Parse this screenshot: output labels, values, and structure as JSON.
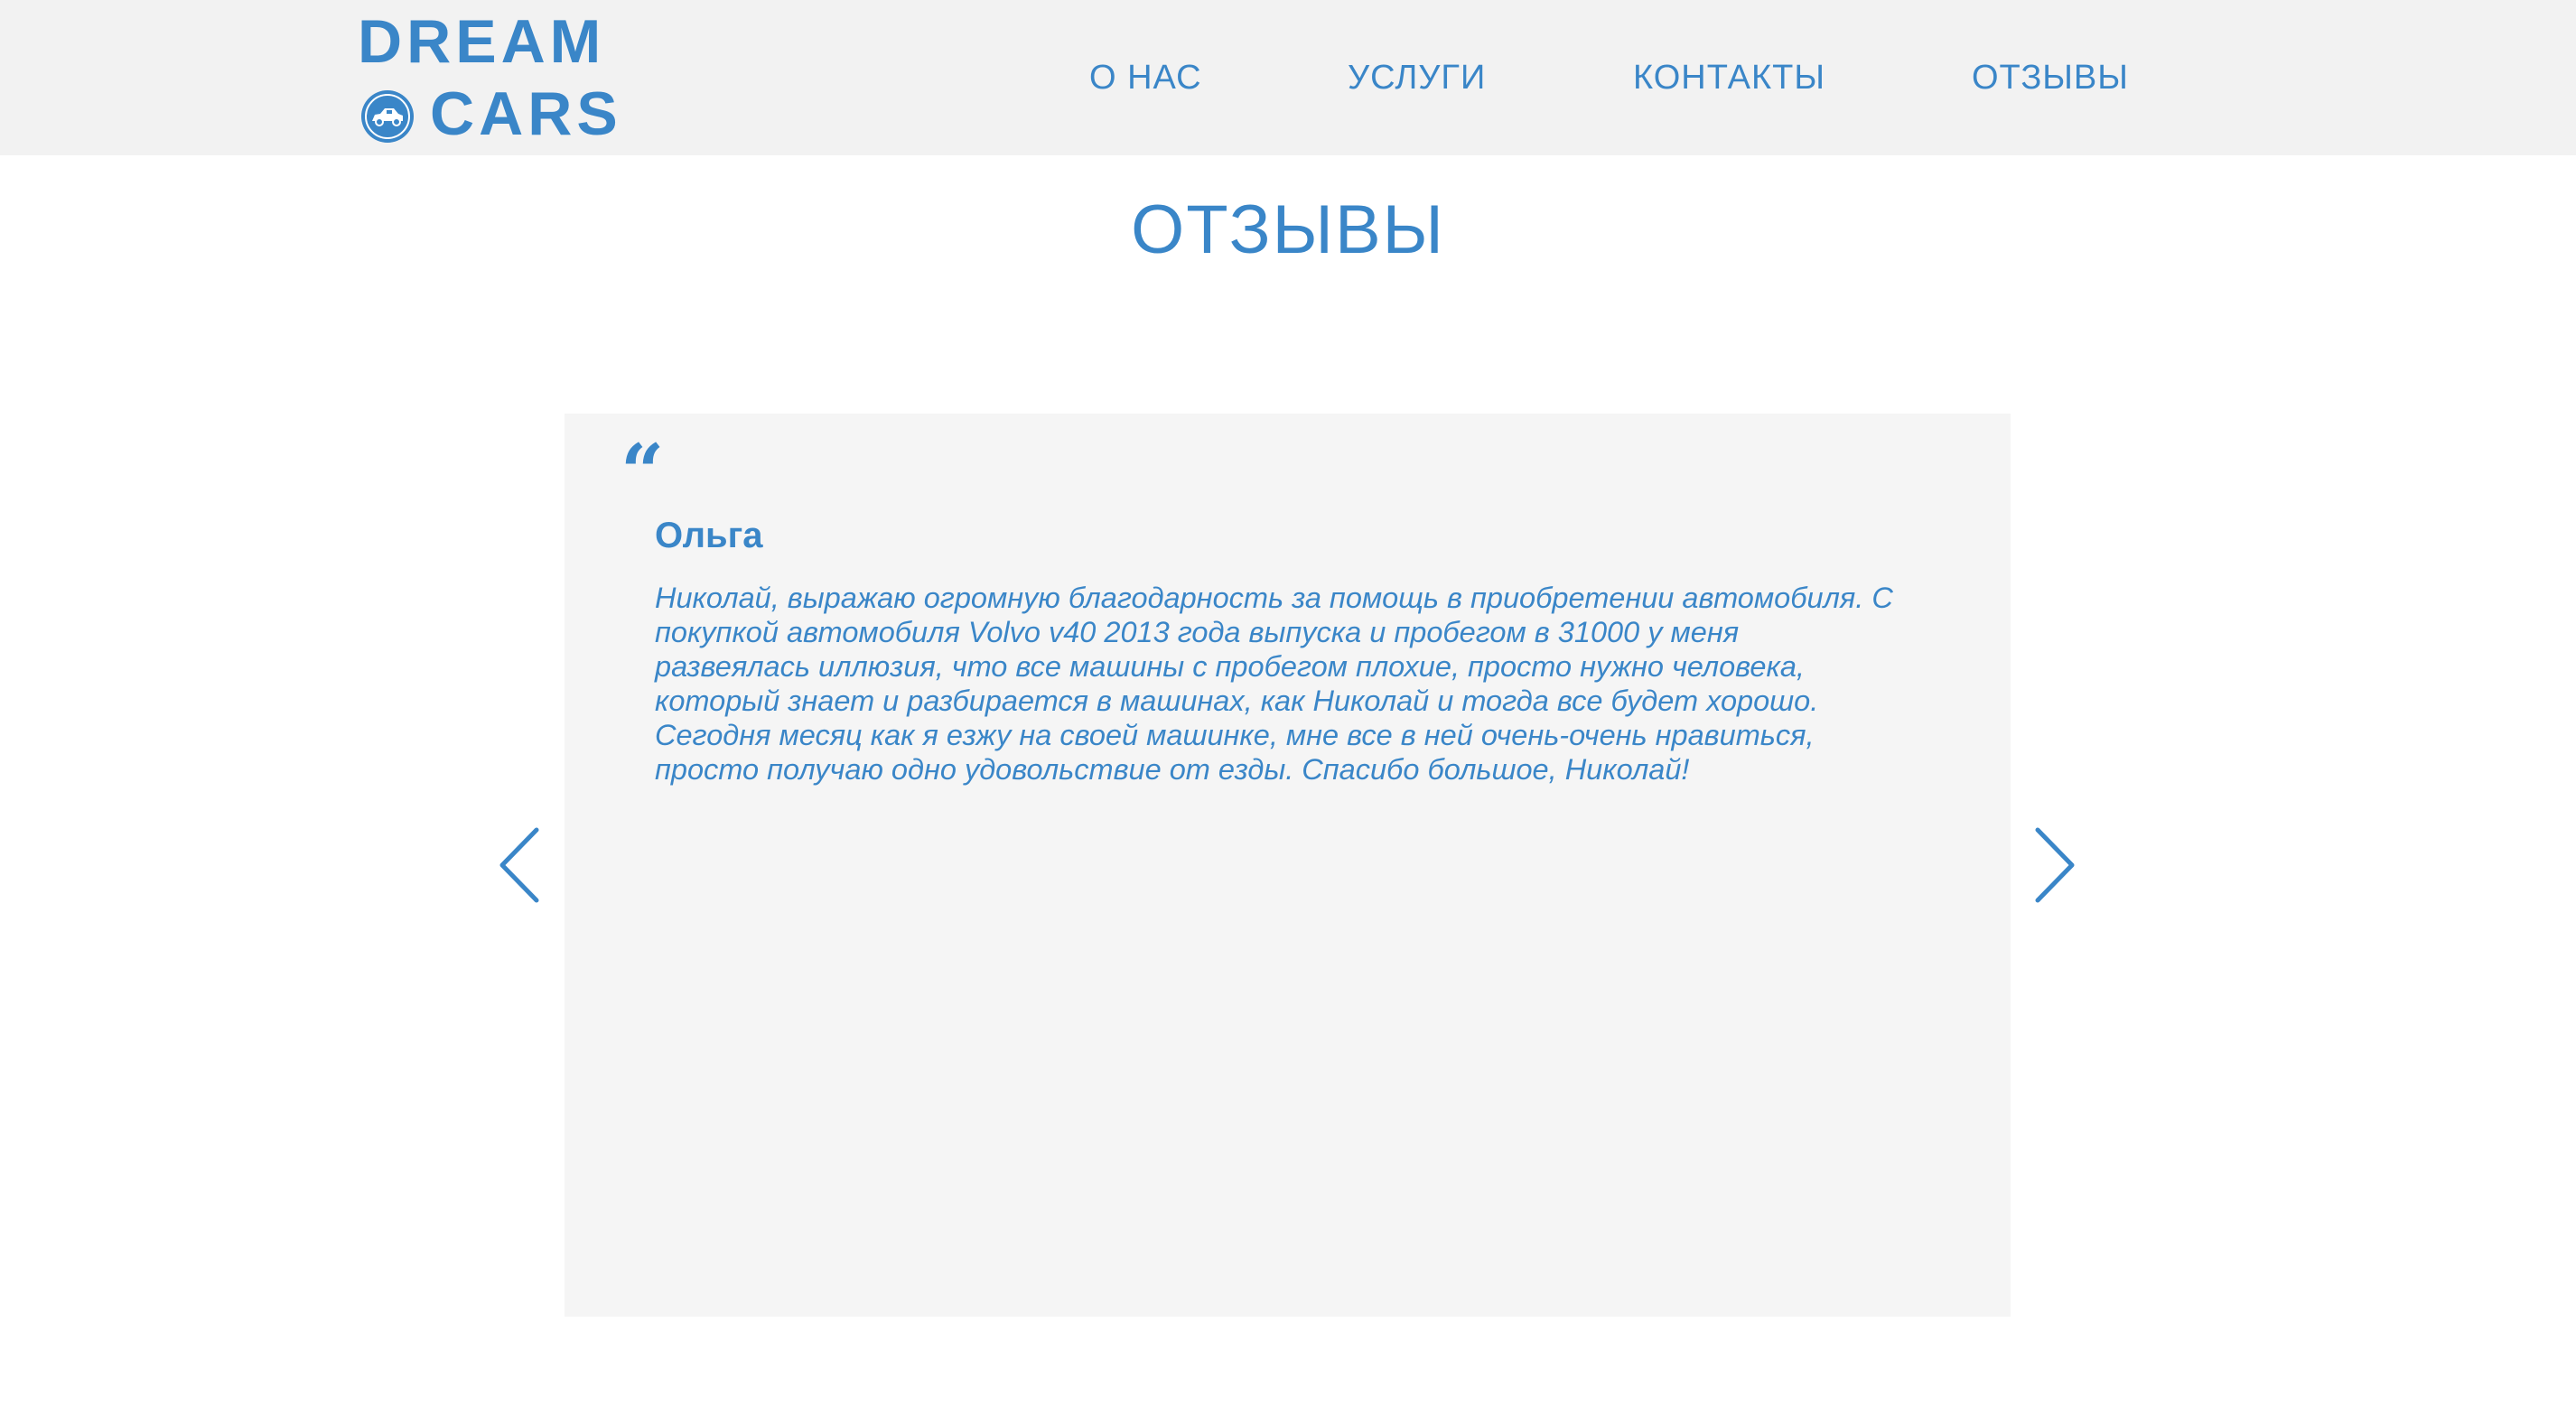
{
  "logo": {
    "line1": "DREAM",
    "line2": "CARS"
  },
  "nav": {
    "items": [
      {
        "label": "О НАС"
      },
      {
        "label": "УСЛУГИ"
      },
      {
        "label": "КОНТАКТЫ"
      },
      {
        "label": "ОТЗЫВЫ"
      }
    ]
  },
  "page": {
    "title": "ОТЗЫВЫ"
  },
  "review": {
    "quote_mark": "“",
    "name": "Ольга",
    "text": "Николай, выражаю огромную благодарность за помощь в приобретении автомобиля. С покупкой автомобиля Volvo v40 2013 года выпуска и пробегом в 31000 у меня развеялась иллюзия, что все машины с пробегом плохие, просто нужно человека, который знает и разбирается в машинах, как Николай и тогда все будет хорошо. Сегодня месяц как я езжу на своей машинке, мне все в ней очень-очень нравиться, просто получаю одно удовольствие от езды. Спасибо большое, Николай!"
  },
  "slider": {
    "prev_icon": "chevron-left-icon",
    "next_icon": "chevron-right-icon"
  },
  "colors": {
    "accent": "#3a86c8",
    "header_bg": "#f2f2f2",
    "card_bg": "#f5f5f5",
    "page_bg": "#ffffff"
  }
}
